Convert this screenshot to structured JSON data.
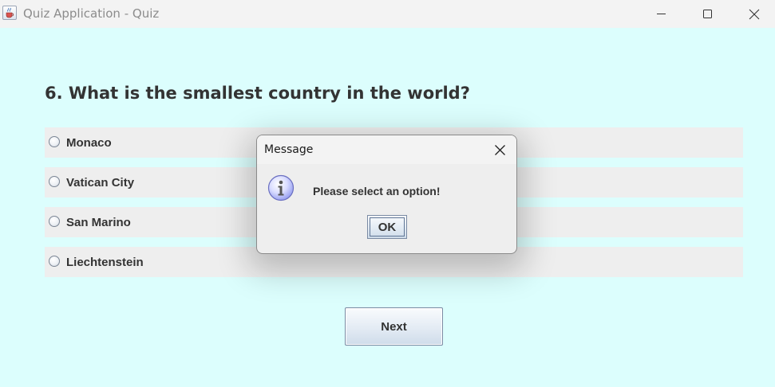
{
  "window": {
    "title": "Quiz Application - Quiz",
    "icon": "java-cup-icon"
  },
  "quiz": {
    "question": "6. What is the smallest country in the world?",
    "options": [
      {
        "label": "Monaco",
        "selected": false
      },
      {
        "label": "Vatican City",
        "selected": false
      },
      {
        "label": "San Marino",
        "selected": false
      },
      {
        "label": "Liechtenstein",
        "selected": false
      }
    ],
    "next_label": "Next"
  },
  "dialog": {
    "title": "Message",
    "message": "Please select an option!",
    "ok_label": "OK",
    "icon": "info-icon"
  },
  "colors": {
    "background": "#dcfefd",
    "option_background": "#eeeeee",
    "titlebar": "#f3f3f3",
    "text": "#333333"
  }
}
